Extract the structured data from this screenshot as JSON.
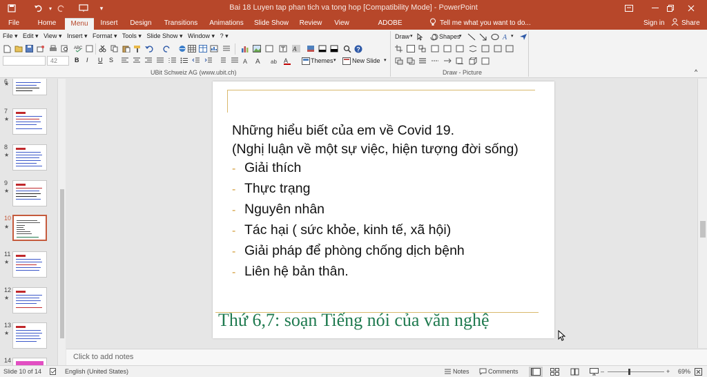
{
  "titlebar": {
    "title": "Bai 18 Luyen tap phan tich va tong hop [Compatibility Mode] - PowerPoint",
    "save_icon": "save-icon",
    "undo_icon": "undo-icon",
    "redo_icon": "redo-icon",
    "customize_icon": "customize-icon"
  },
  "tabs": {
    "items": [
      "File",
      "Home",
      "Menu",
      "Insert",
      "Design",
      "Transitions",
      "Animations",
      "Slide Show",
      "Review",
      "View",
      "ADOBE PRESENTER"
    ],
    "active": "Menu",
    "tell_me": "Tell me what you want to do...",
    "sign_in": "Sign in",
    "share": "Share"
  },
  "ribbon": {
    "menus": [
      "File ▾",
      "Edit ▾",
      "View ▾",
      "Insert ▾",
      "Format ▾",
      "Tools ▾",
      "Slide Show ▾",
      "Window ▾",
      "? ▾"
    ],
    "font_size": "42",
    "themes_label": "Themes",
    "new_slide_label": "New Slide",
    "draw_label": "Draw",
    "shapes_label": "Shapes",
    "group_left_label": "UBit Schweiz AG    (www.ubit.ch)",
    "group_right_label": "Draw - Picture",
    "bold": "B",
    "italic": "I",
    "underline": "U",
    "strike": "S"
  },
  "thumbnails": [
    {
      "num": "6",
      "star": "★"
    },
    {
      "num": "7",
      "star": "★"
    },
    {
      "num": "8",
      "star": "★"
    },
    {
      "num": "9",
      "star": "★"
    },
    {
      "num": "10",
      "star": "★"
    },
    {
      "num": "11",
      "star": "★"
    },
    {
      "num": "12",
      "star": "★"
    },
    {
      "num": "13",
      "star": "★"
    },
    {
      "num": "14",
      "star": ""
    }
  ],
  "slide": {
    "line1": "Những hiểu biết của em về Covid 19.",
    "line2": "(Nghị luận về một sự việc, hiện tượng đời sống)",
    "bullets": [
      "Giải thích",
      "Thực trạng",
      "Nguyên nhân",
      "Tác hại ( sức khỏe, kinh tế, xã hội)",
      "Giải pháp để phòng chống dịch bệnh",
      "Liên hệ bản thân."
    ],
    "footer": "Thứ 6,7: soạn Tiếng nói của văn nghệ"
  },
  "notes": {
    "placeholder": "Click to add notes"
  },
  "status": {
    "slide_of": "Slide 10 of 14",
    "language": "English (United States)",
    "notes": "Notes",
    "comments": "Comments",
    "zoom": "69%",
    "zoom_minus": "–",
    "zoom_plus": "+"
  }
}
